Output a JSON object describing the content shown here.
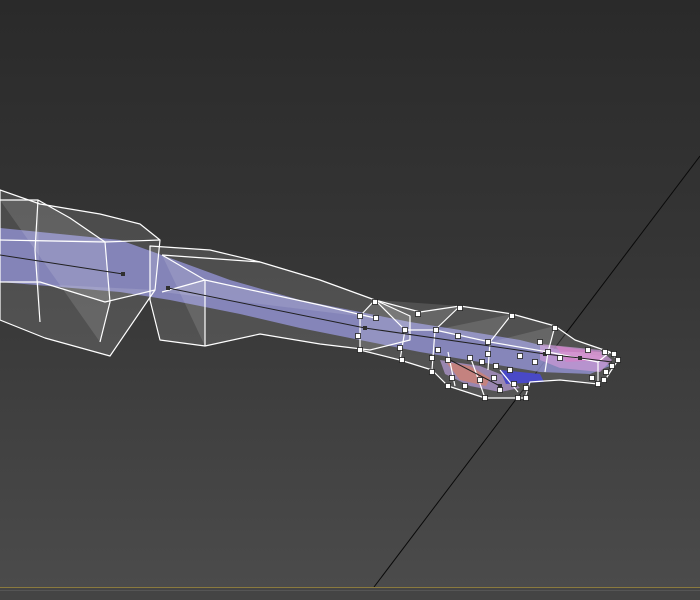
{
  "viewport": {
    "background_top": "#2a2a2a",
    "background_bottom": "#4c4c4c"
  },
  "scene": {
    "wireframe_color": "#ffffff",
    "mesh_fill": "#8a8ad8",
    "bone_color": "#202020",
    "joint_color": "#303030",
    "handle_fill": "#ffffff",
    "handle_stroke": "#202020",
    "accent_red": "#c87060",
    "accent_blue": "#3030c0",
    "accent_pink": "#d070c0",
    "grid_line_color": "#0a0a0a"
  },
  "timeline": {
    "accent": "#8a7a3e"
  }
}
